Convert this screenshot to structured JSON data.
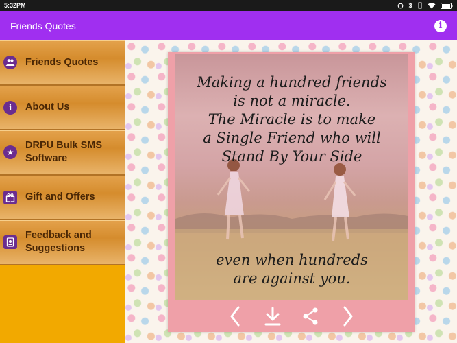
{
  "status_bar": {
    "time": "5:32PM"
  },
  "app_bar": {
    "title": "Friends Quotes",
    "info_icon": "info-icon",
    "color": "#a02ff0"
  },
  "sidebar": {
    "items": [
      {
        "label": "Friends Quotes",
        "icon": "people-icon"
      },
      {
        "label": "About Us",
        "icon": "info-icon"
      },
      {
        "label": "DRPU Bulk SMS Software",
        "icon": "star-icon"
      },
      {
        "label": "Gift and Offers",
        "icon": "gift-icon"
      },
      {
        "label": "Feedback and Suggestions",
        "icon": "feedback-icon"
      }
    ]
  },
  "quote_card": {
    "top_lines": [
      "Making a hundred friends",
      "is not a miracle.",
      "The Miracle is to make",
      "a Single Friend who will",
      "Stand By Your Side"
    ],
    "bottom_lines": [
      "even when hundreds",
      "are against you."
    ]
  },
  "controls": [
    "previous-icon",
    "download-icon",
    "share-icon",
    "next-icon"
  ]
}
